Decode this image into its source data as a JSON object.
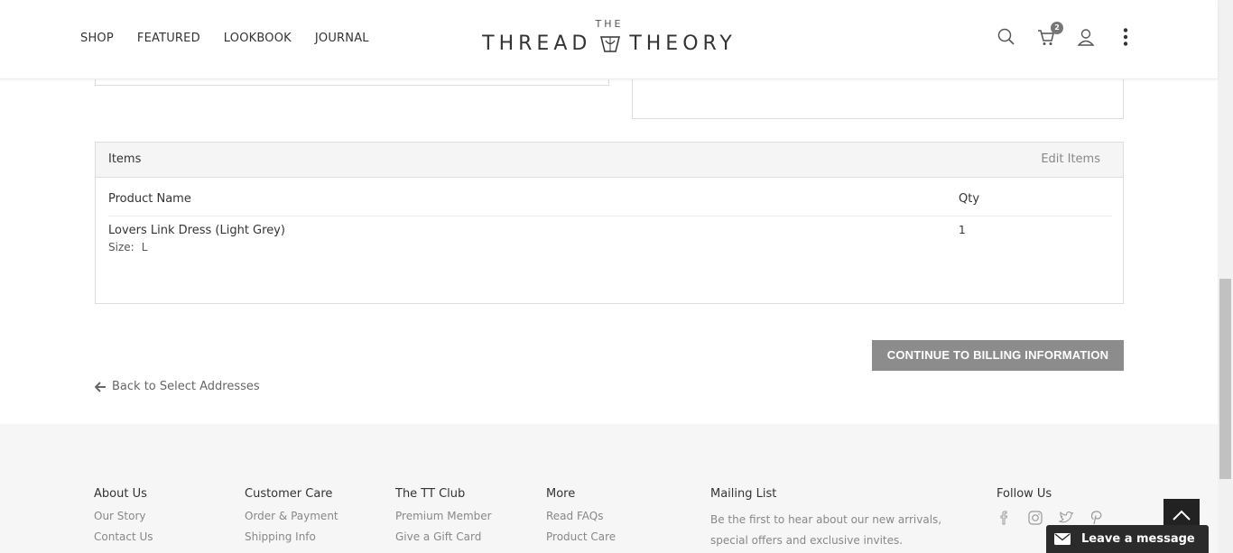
{
  "header": {
    "nav": [
      "SHOP",
      "FEATURED",
      "LOOKBOOK",
      "JOURNAL"
    ],
    "logo_top": "THE",
    "logo_left": "THREAD",
    "logo_right": "THEORY",
    "cart_count": "2"
  },
  "items": {
    "title": "Items",
    "edit_label": "Edit Items",
    "col_product": "Product Name",
    "col_qty": "Qty",
    "rows": [
      {
        "name": "Lovers Link Dress (Light Grey)",
        "size_label": "Size:",
        "size_value": "L",
        "qty": "1"
      }
    ]
  },
  "actions": {
    "continue_label": "CONTINUE TO BILLING INFORMATION",
    "back_label": "Back to Select Addresses"
  },
  "footer": {
    "about": {
      "title": "About Us",
      "links": [
        "Our Story",
        "Contact Us"
      ]
    },
    "care": {
      "title": "Customer Care",
      "links": [
        "Order & Payment",
        "Shipping Info"
      ]
    },
    "club": {
      "title": "The TT Club",
      "links": [
        "Premium Member",
        "Give a Gift Card"
      ]
    },
    "more": {
      "title": "More",
      "links": [
        "Read FAQs",
        "Product Care"
      ]
    },
    "mailing": {
      "title": "Mailing List",
      "text": "Be the first to hear about our new arrivals, special offers and exclusive invites."
    },
    "follow": {
      "title": "Follow Us",
      "icons": [
        "facebook-icon",
        "instagram-icon",
        "twitter-icon",
        "pinterest-icon"
      ]
    }
  },
  "chat": {
    "label": "Leave a message"
  }
}
